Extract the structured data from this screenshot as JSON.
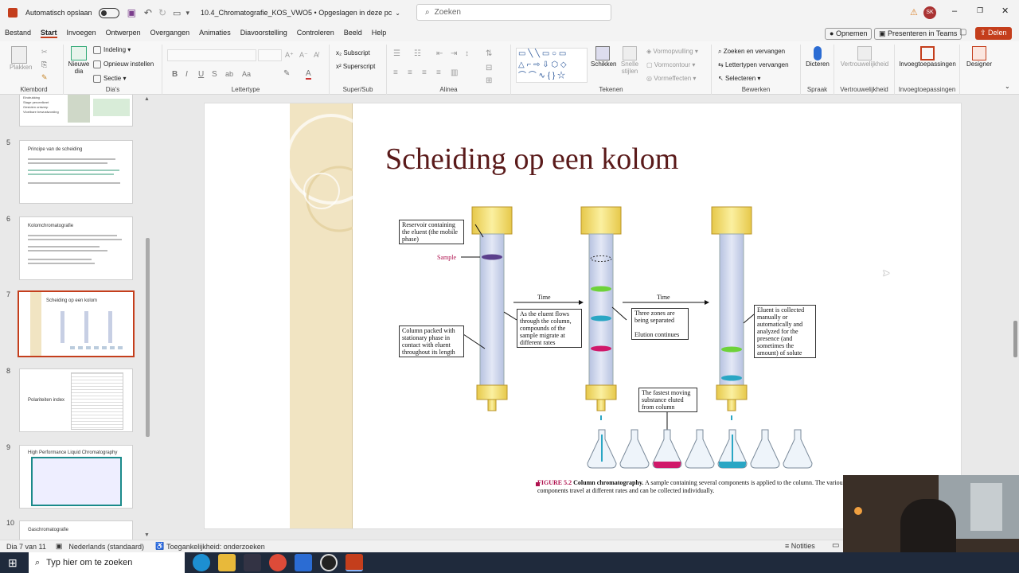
{
  "titlebar": {
    "autosave_label": "Automatisch opslaan",
    "doc_title": "10.4_Chromatografie_KOS_VWO5 • Opgeslagen in deze pc",
    "search_placeholder": "Zoeken",
    "avatar_initials": "SK"
  },
  "menu": {
    "items": [
      "Bestand",
      "Start",
      "Invoegen",
      "Ontwerpen",
      "Overgangen",
      "Animaties",
      "Diavoorstelling",
      "Controleren",
      "Beeld",
      "Help"
    ],
    "record_label": "Opnemen",
    "teams_label": "Presenteren in Teams",
    "share_label": "Delen"
  },
  "ribbon": {
    "paste": "Plakken",
    "clipboard_group": "Klembord",
    "new_slide": "Nieuwe dia",
    "layout": "Indeling",
    "reset": "Opnieuw instellen",
    "section": "Sectie",
    "slides_group": "Dia's",
    "font_group": "Lettertype",
    "subscript": "Subscript",
    "superscript": "Superscript",
    "supsub_group": "Super/Sub",
    "paragraph_group": "Alinea",
    "arrange": "Schikken",
    "quick_styles": "Snelle stijlen",
    "shape_fill": "Vormopvulling",
    "shape_outline": "Vormcontour",
    "shape_effects": "Vormeffecten",
    "drawing_group": "Tekenen",
    "find_replace": "Zoeken en vervangen",
    "replace_fonts": "Lettertypen vervangen",
    "select": "Selecteren",
    "editing_group": "Bewerken",
    "dictate": "Dicteren",
    "speech_group": "Spraak",
    "sensitivity": "Vertrouwelijkheid",
    "sensitivity_group": "Vertrouwelijkheid",
    "addins": "Invoegtoepassingen",
    "addins_group": "Invoegtoepassingen",
    "designer": "Designer"
  },
  "thumbnails": [
    {
      "num": "5",
      "title": "Principe van de scheiding"
    },
    {
      "num": "6",
      "title": "Kolomchromatografie"
    },
    {
      "num": "7",
      "title": "Scheiding op een kolom"
    },
    {
      "num": "8",
      "title": "Polariteiten index"
    },
    {
      "num": "9",
      "title": "High Performance Liquid Chromatography"
    },
    {
      "num": "10",
      "title": "Gaschromatografie"
    }
  ],
  "thumb_top_lines": [
    "Eindrukking",
    "Stage perceelkeet",
    "Gesloten ontwerp",
    "Vloeibare bewustwording"
  ],
  "slide": {
    "title": "Scheiding op een kolom",
    "labels": {
      "reservoir": "Reservoir containing the eluent (the mobile phase)",
      "sample": "Sample",
      "column_packed": "Column packed with stationary phase in contact with eluent throughout its length",
      "time1": "Time",
      "time2": "Time",
      "eluent_flows": "As the eluent flows through the column, compounds of the sample migrate at different rates",
      "three_zones": "Three zones are being separated",
      "elution": "Elution continues",
      "eluent_collected": "Eluent is collected manually or automatically and analyzed for the presence (and sometimes the amount) of solute",
      "fastest": "The fastest moving substance eluted from column"
    },
    "caption_fig": "FIGURE 5.2",
    "caption_bold": "Column chromatography.",
    "caption_text": "A sample containing several components is applied to the column. The various components travel at different rates and can be collected individually."
  },
  "status": {
    "slide_of": "Dia 7 van 11",
    "language": "Nederlands (standaard)",
    "accessibility": "Toegankelijkheid: onderzoeken",
    "notes": "Notities"
  },
  "taskbar": {
    "search_placeholder": "Typ hier om te zoeken"
  },
  "colors": {
    "accent": "#c43e1c",
    "title": "#5a1a1a",
    "zone_purple": "#5b3f8c",
    "zone_green": "#6ed23a",
    "zone_cyan": "#2aa6c4",
    "zone_magenta": "#d0186a"
  }
}
